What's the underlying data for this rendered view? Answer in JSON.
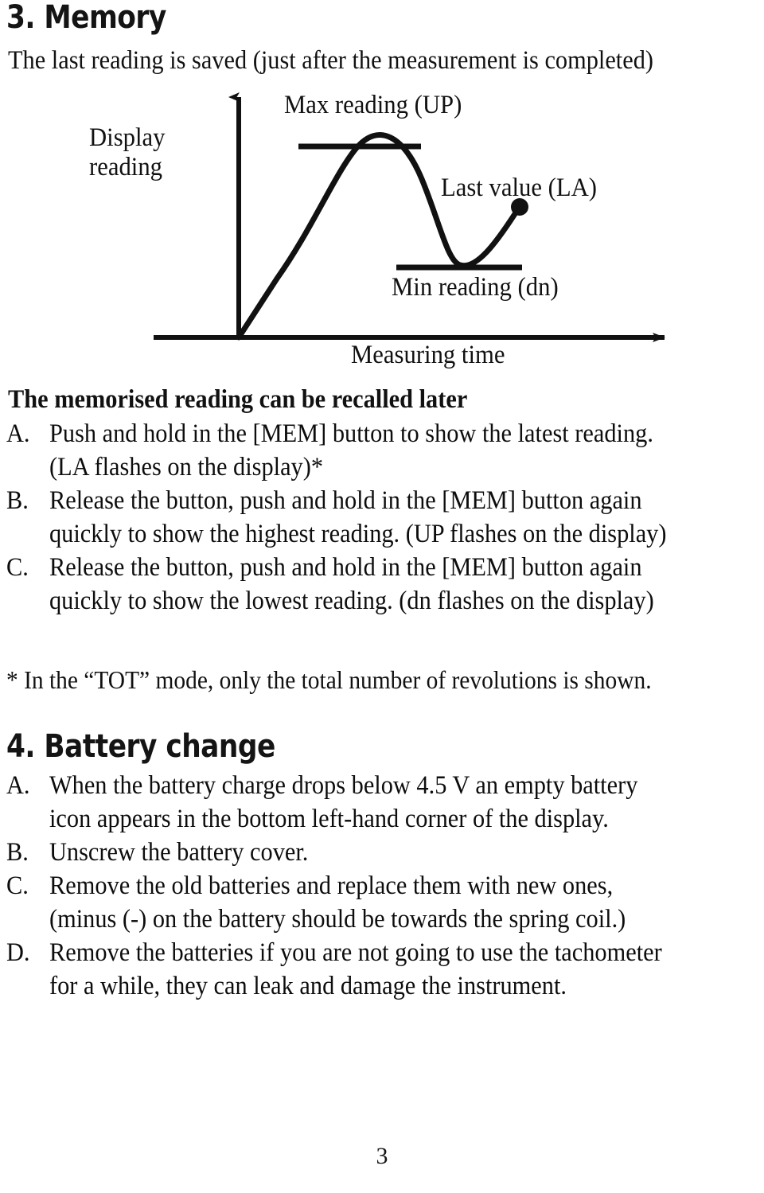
{
  "document": {
    "page_number": "3"
  },
  "sections": [
    {
      "heading": "3. Memory",
      "intro": "The last reading is saved (just after the measurement is completed)",
      "subheading": "The memorised reading can be recalled later",
      "items": [
        {
          "marker": "A.",
          "lines": [
            "Push and hold in the [MEM] button to show the latest reading.",
            "(LA flashes on the display)*"
          ]
        },
        {
          "marker": "B.",
          "lines": [
            "Release the button, push and hold in the [MEM] button again",
            "quickly to show the highest reading. (UP flashes on the display)"
          ]
        },
        {
          "marker": "C.",
          "lines": [
            "Release the button, push and hold in the [MEM] button again",
            "quickly to show the lowest reading. (dn flashes on the display)"
          ]
        }
      ],
      "footnote": "* In the “TOT” mode, only the total number of revolutions is shown."
    },
    {
      "heading": "4. Battery change",
      "items": [
        {
          "marker": "A.",
          "lines": [
            "When the battery charge drops below 4.5 V an empty battery",
            "icon appears in the bottom left-hand corner of the display."
          ]
        },
        {
          "marker": "B.",
          "lines": [
            "Unscrew the battery cover."
          ]
        },
        {
          "marker": "C.",
          "lines": [
            "Remove the old batteries and replace them with new ones,",
            "(minus (-) on the battery should be towards the spring coil.)"
          ]
        },
        {
          "marker": "D.",
          "lines": [
            "Remove the batteries if you are not going to use the tachometer",
            "for a while, they can leak and damage the instrument."
          ]
        }
      ]
    }
  ],
  "diagram": {
    "y_axis_label_line1": "Display",
    "y_axis_label_line2": "reading",
    "x_axis_label": "Measuring time",
    "max_label": "Max reading (UP)",
    "last_label": "Last value (LA)",
    "min_label": "Min reading (dn)",
    "stroke_color": "#111111"
  }
}
